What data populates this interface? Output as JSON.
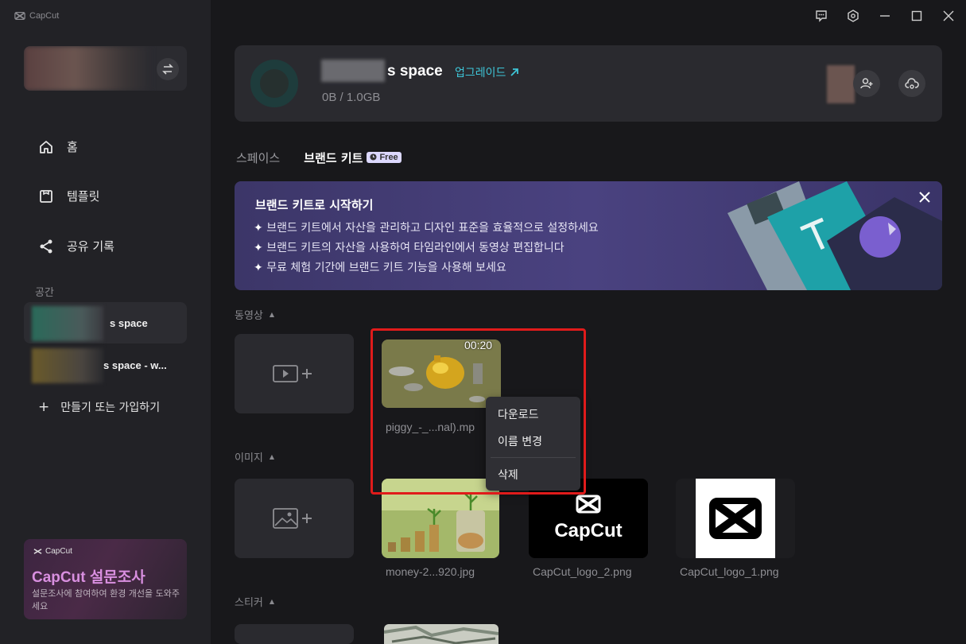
{
  "app": {
    "name": "CapCut"
  },
  "sidebar": {
    "nav": [
      {
        "label": "홈",
        "icon": "home-icon"
      },
      {
        "label": "템플릿",
        "icon": "template-icon"
      },
      {
        "label": "공유 기록",
        "icon": "share-icon"
      }
    ],
    "section_label": "공간",
    "spaces": [
      {
        "name": "s space",
        "active": true
      },
      {
        "name": "s space - w..."
      }
    ],
    "create_join": "만들기 또는 가입하기",
    "survey": {
      "brand": "CapCut",
      "title": "CapCut 설문조사",
      "desc": "설문조사에 참여하여 환경 개선을 도와주세요"
    }
  },
  "space_card": {
    "title": "s space",
    "upgrade": "업그레이드",
    "storage": "0B / 1.0GB"
  },
  "tabs": [
    {
      "label": "스페이스",
      "active": false
    },
    {
      "label": "브랜드 키트",
      "active": true,
      "badge": "Free"
    }
  ],
  "banner": {
    "title": "브랜드 키트로 시작하기",
    "bullets": [
      "브랜드 키트에서 자산을 관리하고 디자인 표준을 효율적으로 설정하세요",
      "브랜드 키트의 자산을 사용하여 타임라인에서 동영상 편집합니다",
      "무료 체험 기간에 브랜드 키트 기능을 사용해 보세요"
    ]
  },
  "groups": {
    "video": "동영상",
    "image": "이미지",
    "sticker": "스티커"
  },
  "videos": [
    {
      "name": "piggy_-_...nal).mp",
      "duration": "00:20"
    }
  ],
  "images": [
    {
      "name": "money-2...920.jpg"
    },
    {
      "name": "CapCut_logo_2.png",
      "logo_text": "CapCut"
    },
    {
      "name": "CapCut_logo_1.png"
    }
  ],
  "context_menu": {
    "items": [
      "다운로드",
      "이름 변경",
      "삭제"
    ]
  },
  "colors": {
    "accent": "#3ec6d8",
    "highlight": "#e01b1b",
    "banner": "#4a4280"
  }
}
